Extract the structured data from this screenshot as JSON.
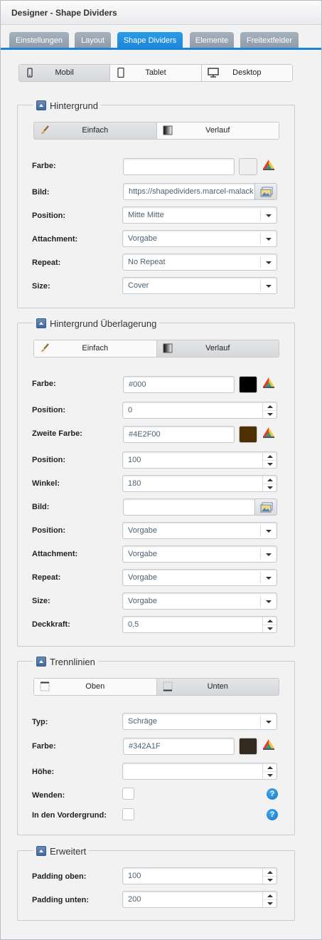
{
  "window": {
    "title": "Designer - Shape Dividers"
  },
  "tabs": [
    {
      "label": "Einstellungen"
    },
    {
      "label": "Layout"
    },
    {
      "label": "Shape Dividers",
      "active": true
    },
    {
      "label": "Elemente"
    },
    {
      "label": "Freitextfelder"
    }
  ],
  "device_switch": {
    "items": [
      {
        "label": "Mobil",
        "icon": "phone-icon",
        "active": true
      },
      {
        "label": "Tablet",
        "icon": "tablet-icon"
      },
      {
        "label": "Desktop",
        "icon": "monitor-icon"
      }
    ]
  },
  "background": {
    "title": "Hintergrund",
    "mode": {
      "items": [
        {
          "label": "Einfach",
          "icon": "brush-icon",
          "active": true
        },
        {
          "label": "Verlauf",
          "icon": "gradient-icon"
        }
      ]
    },
    "color_label": "Farbe:",
    "color_value": "",
    "color_swatch": "#efefef",
    "image_label": "Bild:",
    "image_value": "https://shapedividers.marcel-malack",
    "position_label": "Position:",
    "position_value": "Mitte Mitte",
    "attachment_label": "Attachment:",
    "attachment_value": "Vorgabe",
    "repeat_label": "Repeat:",
    "repeat_value": "No Repeat",
    "size_label": "Size:",
    "size_value": "Cover"
  },
  "overlay": {
    "title": "Hintergrund Überlagerung",
    "mode": {
      "items": [
        {
          "label": "Einfach",
          "icon": "brush-icon"
        },
        {
          "label": "Verlauf",
          "icon": "gradient-icon",
          "active": true
        }
      ]
    },
    "color_label": "Farbe:",
    "color_value": "#000",
    "color_swatch": "#000000",
    "position1_label": "Position:",
    "position1_value": "0",
    "color2_label": "Zweite Farbe:",
    "color2_value": "#4E2F00",
    "color2_swatch": "#4E2F00",
    "position2_label": "Position:",
    "position2_value": "100",
    "angle_label": "Winkel:",
    "angle_value": "180",
    "image_label": "Bild:",
    "image_value": "",
    "img_position_label": "Position:",
    "img_position_value": "Vorgabe",
    "attachment_label": "Attachment:",
    "attachment_value": "Vorgabe",
    "repeat_label": "Repeat:",
    "repeat_value": "Vorgabe",
    "size_label": "Size:",
    "size_value": "Vorgabe",
    "opacity_label": "Deckkraft:",
    "opacity_value": "0,5"
  },
  "dividers": {
    "title": "Trennlinien",
    "mode": {
      "items": [
        {
          "label": "Oben",
          "icon": "top-border-icon"
        },
        {
          "label": "Unten",
          "icon": "bottom-border-icon",
          "active": true
        }
      ]
    },
    "type_label": "Typ:",
    "type_value": "Schräge",
    "color_label": "Farbe:",
    "color_value": "#342A1F",
    "color_swatch": "#342A1F",
    "height_label": "Höhe:",
    "height_value": "",
    "flip_label": "Wenden:",
    "flip_checked": false,
    "front_label": "In den Vordergrund:",
    "front_checked": false,
    "help": "?"
  },
  "advanced": {
    "title": "Erweitert",
    "padding_top_label": "Padding oben:",
    "padding_top_value": "100",
    "padding_bottom_label": "Padding unten:",
    "padding_bottom_value": "200"
  }
}
